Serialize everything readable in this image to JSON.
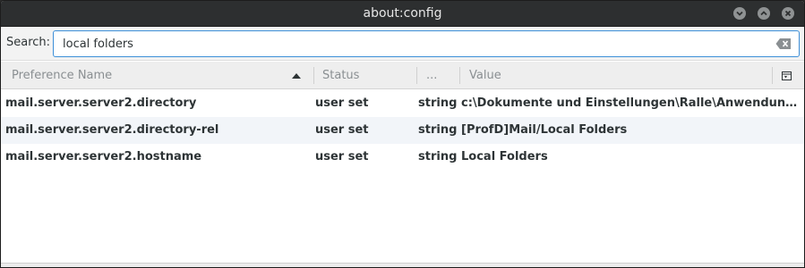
{
  "window": {
    "title": "about:config"
  },
  "search": {
    "label": "Search:",
    "value": "local folders",
    "placeholder": ""
  },
  "columns": {
    "name": "Preference Name",
    "status": "Status",
    "type": "...",
    "value": "Value"
  },
  "rows": [
    {
      "name": "mail.server.server2.directory",
      "status": "user set",
      "type": "string",
      "value": "c:\\Dokumente und Einstellungen\\Ralle\\Anwendungsdat..."
    },
    {
      "name": "mail.server.server2.directory-rel",
      "status": "user set",
      "type": "string",
      "value": "[ProfD]Mail/Local Folders"
    },
    {
      "name": "mail.server.server2.hostname",
      "status": "user set",
      "type": "string",
      "value": "Local Folders"
    }
  ],
  "icons": {
    "minimize": "minimize-icon",
    "maximize": "maximize-icon",
    "close": "close-icon",
    "clear": "clear-text-icon",
    "column_picker": "column-picker-icon",
    "sort": "sort-ascending-icon"
  },
  "colors": {
    "titlebar": "#2d2f30",
    "focus_border": "#3d8fd8",
    "alt_row": "#f2f5f9"
  }
}
